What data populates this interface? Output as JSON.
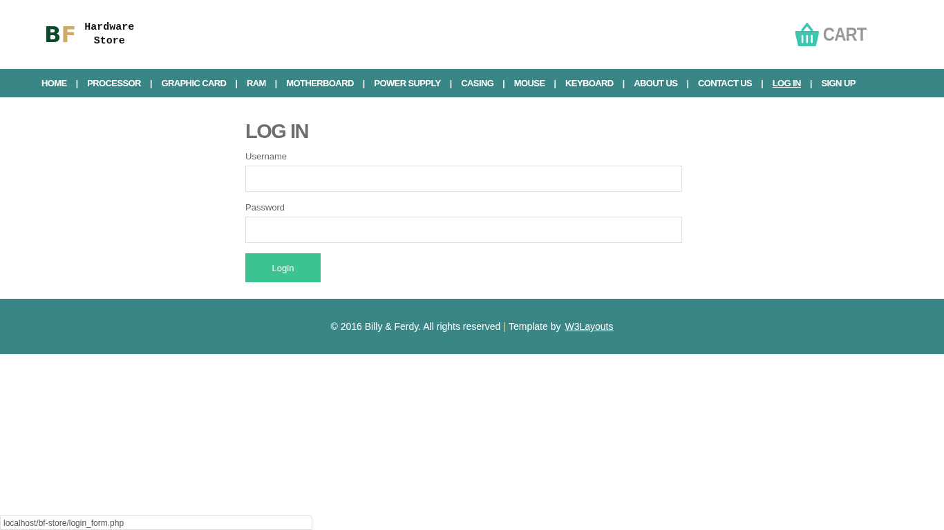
{
  "logo": {
    "initials": [
      "B",
      "F"
    ],
    "name_lines": [
      "Hardware",
      "Store"
    ]
  },
  "cart": {
    "label": "CART"
  },
  "nav": {
    "separator": "|",
    "items": [
      {
        "label": "HOME",
        "selected": false
      },
      {
        "label": "PROCESSOR",
        "selected": false
      },
      {
        "label": "GRAPHIC CARD",
        "selected": false
      },
      {
        "label": "RAM",
        "selected": false
      },
      {
        "label": "MOTHERBOARD",
        "selected": false
      },
      {
        "label": "POWER SUPPLY",
        "selected": false
      },
      {
        "label": "CASING",
        "selected": false
      },
      {
        "label": "MOUSE",
        "selected": false
      },
      {
        "label": "KEYBOARD",
        "selected": false
      },
      {
        "label": "ABOUT US",
        "selected": false
      },
      {
        "label": "CONTACT US",
        "selected": false
      },
      {
        "label": "LOG IN",
        "selected": true
      },
      {
        "label": "SIGN UP",
        "selected": false
      }
    ]
  },
  "login_form": {
    "title": "LOG IN",
    "fields": [
      {
        "label": "Username"
      },
      {
        "label": "Password"
      }
    ],
    "submit": "Login"
  },
  "footer": {
    "copyright": "© 2016 Billy & Ferdy. All rights reserved",
    "separator": "|",
    "credit": "Template by",
    "link": "W3Layouts"
  },
  "status_bar": {
    "url": "localhost/bf-store/login_form.php"
  }
}
